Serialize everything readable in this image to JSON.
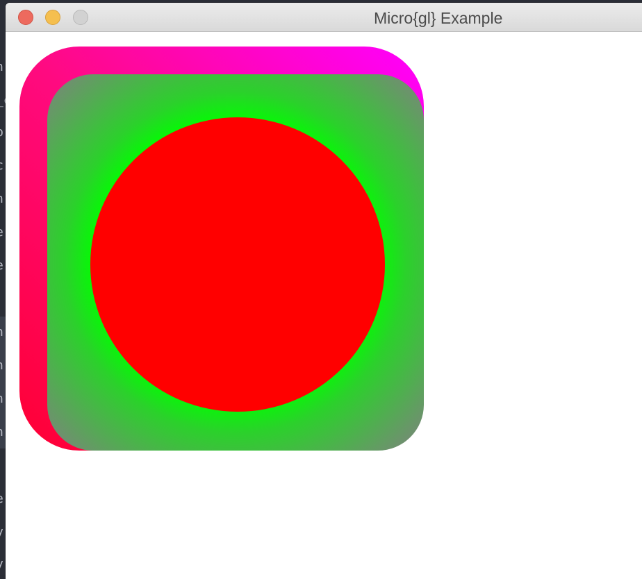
{
  "window": {
    "title": "Micro{gl} Example"
  },
  "background_editor": {
    "glyphs": [
      "n",
      "_c",
      "b",
      "c",
      "n",
      "e",
      "e",
      "n",
      "n",
      "n",
      "n",
      "e",
      "y",
      "y"
    ]
  },
  "canvas": {
    "shapes": {
      "outer_rect": {
        "gradient": "linear",
        "colors": [
          "#ff0033",
          "#ff0a80",
          "#ff00ff"
        ]
      },
      "inner_rect": {
        "gradient": "radial",
        "colors": [
          "#00ff00",
          "#808080"
        ]
      },
      "circle": {
        "gradient": "radial",
        "colors": [
          "#ff0000",
          "#00ff00"
        ]
      }
    }
  }
}
